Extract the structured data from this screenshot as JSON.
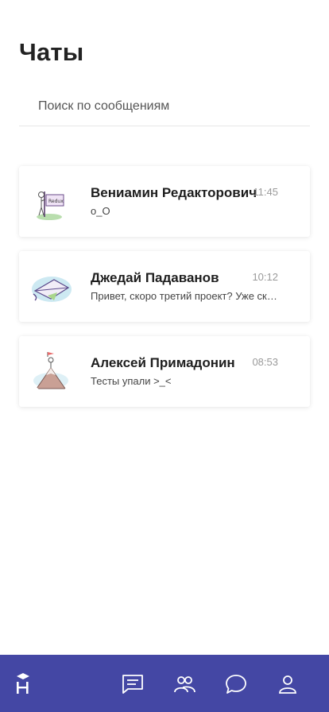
{
  "header": {
    "title": "Чаты"
  },
  "search": {
    "placeholder": "Поиск по сообщениям",
    "value": ""
  },
  "chats": [
    {
      "name": "Вениамин Редакторович",
      "time": "11:45",
      "preview": "o_O",
      "avatar": "editor-avatar"
    },
    {
      "name": "Джедай Падаванов",
      "time": "10:12",
      "preview": "Привет, скоро третий проект? Уже скоро начнется",
      "avatar": "envelope-avatar"
    },
    {
      "name": "Алексей Примадонин",
      "time": "08:53",
      "preview": "Тесты упали >_<",
      "avatar": "mountain-avatar"
    }
  ],
  "nav": {
    "logo": "app-logo-icon",
    "items": [
      "chats-list-icon",
      "contacts-icon",
      "messages-icon",
      "profile-icon"
    ]
  },
  "colors": {
    "nav_bg": "#4447a4",
    "nav_icon": "#ffffff",
    "time": "#9a9a9a"
  }
}
